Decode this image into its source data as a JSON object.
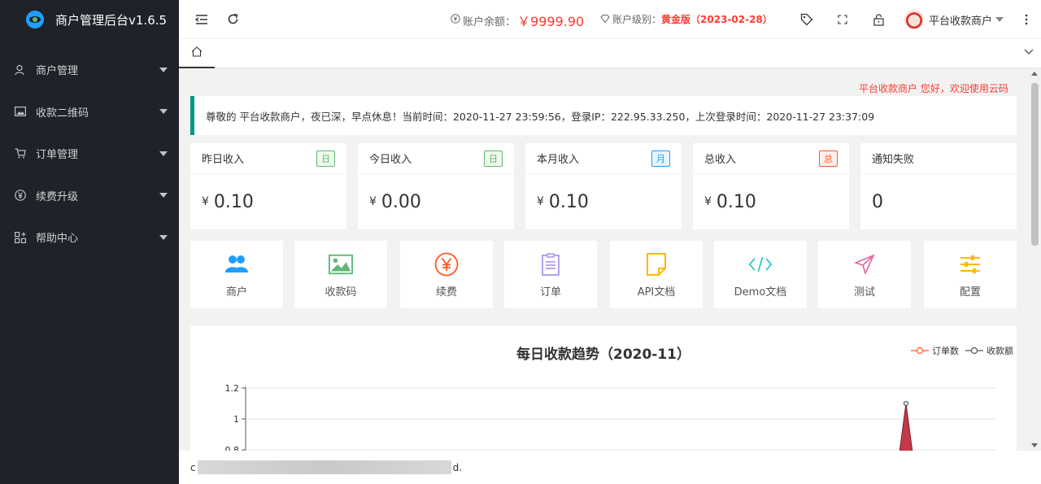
{
  "app": {
    "title": "商户管理后台v1.6.5"
  },
  "sidebar": {
    "items": [
      {
        "label": "商户管理",
        "icon": "user-icon"
      },
      {
        "label": "收款二维码",
        "icon": "image-icon"
      },
      {
        "label": "订单管理",
        "icon": "cart-icon"
      },
      {
        "label": "续费升级",
        "icon": "yen-icon"
      },
      {
        "label": "帮助中心",
        "icon": "apps-icon"
      }
    ]
  },
  "header": {
    "balance_label": "账户余额：",
    "balance_value": "￥9999.90",
    "level_label": "账户级别：",
    "level_value": "黄金版（2023-02-28）",
    "user_name": "平台收款商户"
  },
  "marquee": "平台收款商户 您好，欢迎使用云码",
  "notice": "尊敬的 平台收款商户，夜已深，早点休息！当前时间：2020-11-27 23:59:56，登录IP：222.95.33.250，上次登录时间：2020-11-27 23:37:09",
  "stats": [
    {
      "label": "昨日收入",
      "badge": "日",
      "badge_color": "#5fb878",
      "currency": "¥",
      "value": "0.10"
    },
    {
      "label": "今日收入",
      "badge": "日",
      "badge_color": "#5fb878",
      "currency": "¥",
      "value": "0.00"
    },
    {
      "label": "本月收入",
      "badge": "月",
      "badge_color": "#1e9fff",
      "currency": "¥",
      "value": "0.10"
    },
    {
      "label": "总收入",
      "badge": "总",
      "badge_color": "#ff5722",
      "currency": "¥",
      "value": "0.10"
    },
    {
      "label": "通知失败",
      "badge": "",
      "badge_color": "",
      "currency": "",
      "value": "0"
    }
  ],
  "quick": [
    {
      "label": "商户",
      "icon": "users-icon",
      "color": "#1e9fff"
    },
    {
      "label": "收款码",
      "icon": "picture-icon",
      "color": "#5fb878"
    },
    {
      "label": "续费",
      "icon": "yen-circle-icon",
      "color": "#ff5722"
    },
    {
      "label": "订单",
      "icon": "clipboard-icon",
      "color": "#a28be8"
    },
    {
      "label": "API文档",
      "icon": "document-icon",
      "color": "#ffb800"
    },
    {
      "label": "Demo文档",
      "icon": "code-icon",
      "color": "#2ec7c9"
    },
    {
      "label": "测试",
      "icon": "send-icon",
      "color": "#e066a3"
    },
    {
      "label": "配置",
      "icon": "sliders-icon",
      "color": "#ffb800"
    }
  ],
  "chart_data": {
    "type": "line",
    "title": "每日收款趋势（2020-11）",
    "series": [
      {
        "name": "订单数",
        "color": "#ff5722"
      },
      {
        "name": "收款额",
        "color": "#555555",
        "peak_value": 1.1
      }
    ],
    "y_ticks": [
      "1.2",
      "1",
      "0.8"
    ],
    "ylim": [
      0.8,
      1.2
    ],
    "grid": true,
    "legend_position": "top-right"
  },
  "footer": {
    "prefix": "c",
    "suffix": "d."
  }
}
